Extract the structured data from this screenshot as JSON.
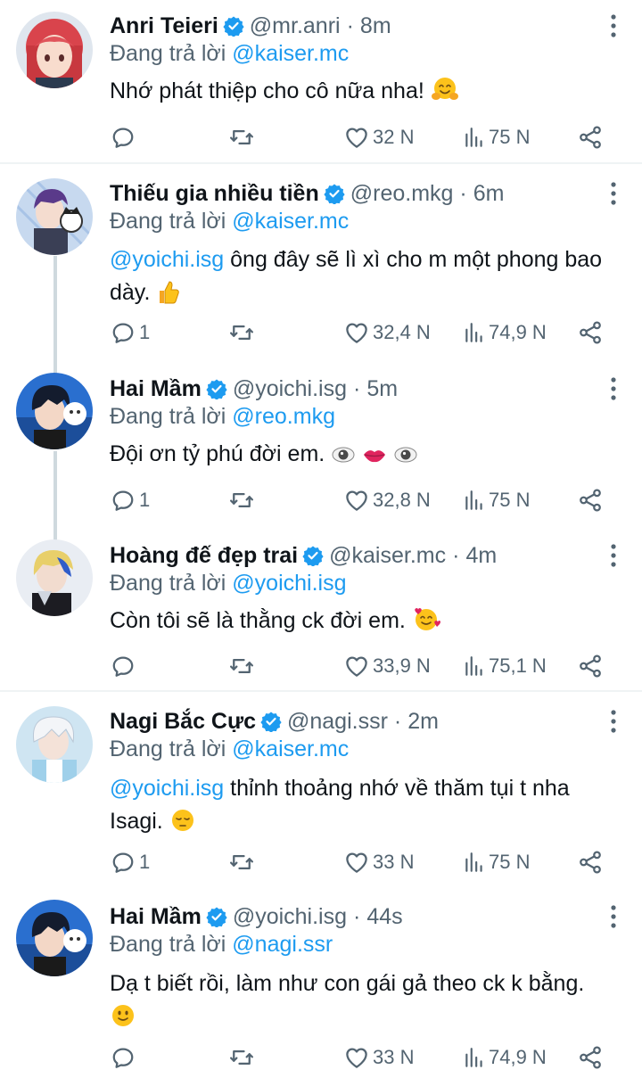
{
  "colors": {
    "accent": "#1d9bf0",
    "muted": "#536471",
    "text": "#0f1419",
    "line": "#cfd9de"
  },
  "icons": {
    "reply": "comment-icon",
    "retweet": "retweet-icon",
    "like": "heart-icon",
    "views": "views-icon",
    "share": "share-icon",
    "more": "more-vertical-icon",
    "verified": "verified-badge-icon"
  },
  "tweets": [
    {
      "name": "Anri Teieri",
      "handle": "@mr.anri",
      "sep": "·",
      "time": "8m",
      "replying_label": "Đang trả lời",
      "replying_to": "@kaiser.mc",
      "mention": "",
      "text": "Nhớ phát thiệp cho cô nữa nha!",
      "replies": "",
      "likes": "32 N",
      "views": "75 N"
    },
    {
      "name": "Thiếu gia nhiều tiền",
      "handle": "@reo.mkg",
      "sep": "·",
      "time": "6m",
      "replying_label": "Đang trả lời",
      "replying_to": "@kaiser.mc",
      "mention": "@yoichi.isg",
      "text": " ông đây sẽ lì xì cho m một phong bao dày.",
      "replies": "1",
      "likes": "32,4 N",
      "views": "74,9 N"
    },
    {
      "name": "Hai Mầm",
      "handle": "@yoichi.isg",
      "sep": "·",
      "time": "5m",
      "replying_label": "Đang trả lời",
      "replying_to": "@reo.mkg",
      "mention": "",
      "text": "Đội ơn tỷ phú đời em.",
      "replies": "1",
      "likes": "32,8 N",
      "views": "75 N"
    },
    {
      "name": "Hoàng đế đẹp trai",
      "handle": "@kaiser.mc",
      "sep": "·",
      "time": "4m",
      "replying_label": "Đang trả lời",
      "replying_to": "@yoichi.isg",
      "mention": "",
      "text": "Còn tôi sẽ là thằng ck đời em.",
      "replies": "",
      "likes": "33,9 N",
      "views": "75,1 N"
    },
    {
      "name": "Nagi Bắc Cực",
      "handle": "@nagi.ssr",
      "sep": "·",
      "time": "2m",
      "replying_label": "Đang trả lời",
      "replying_to": "@kaiser.mc",
      "mention": "@yoichi.isg",
      "text": " thỉnh thoảng nhớ về thăm tụi t nha Isagi.",
      "replies": "1",
      "likes": "33 N",
      "views": "75 N"
    },
    {
      "name": "Hai Mầm",
      "handle": "@yoichi.isg",
      "sep": "·",
      "time": "44s",
      "replying_label": "Đang trả lời",
      "replying_to": "@nagi.ssr",
      "mention": "",
      "text": "Dạ t biết rồi, làm như con gái gả theo ck k bằng.",
      "replies": "",
      "likes": "33 N",
      "views": "74,9 N"
    }
  ]
}
